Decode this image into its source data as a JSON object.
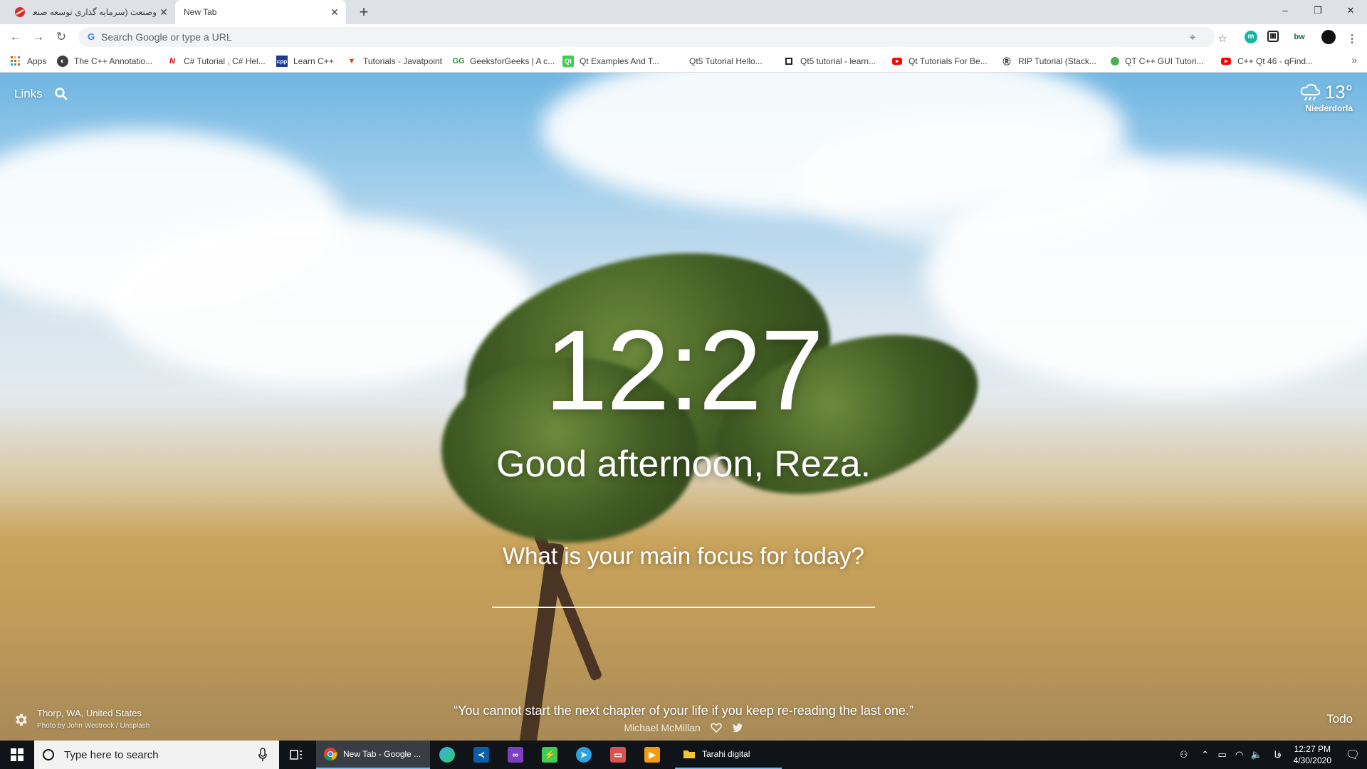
{
  "browser": {
    "tabs": [
      {
        "label": "وصنعت (سرمایه گذاری توسعه صنعت",
        "active": false
      },
      {
        "label": "New Tab",
        "active": true
      }
    ],
    "window_controls": {
      "minimize": "–",
      "restore": "❐",
      "close": "✕"
    }
  },
  "toolbar": {
    "omnibox_placeholder": "Search Google or type a URL"
  },
  "bookmarks": [
    {
      "label": "Apps",
      "icon": "apps-grid-icon"
    },
    {
      "label": "The C++ Annotatio...",
      "icon": "globe-icon"
    },
    {
      "label": "C# Tutorial , C# Hel...",
      "icon": "n-logo-icon"
    },
    {
      "label": "Learn C++",
      "icon": "cpp-logo-icon"
    },
    {
      "label": "Tutorials - Javatpoint",
      "icon": "javatpoint-logo-icon"
    },
    {
      "label": "GeeksforGeeks | A c...",
      "icon": "geeksforgeeks-logo-icon"
    },
    {
      "label": "Qt Examples And T...",
      "icon": "qt-logo-icon"
    },
    {
      "label": "Qt5 Tutorial Hello...",
      "icon": "blank-page-icon"
    },
    {
      "label": "Qt5 tutorial - learn...",
      "icon": "square-outline-icon"
    },
    {
      "label": "Qt Tutorials For Be...",
      "icon": "youtube-icon"
    },
    {
      "label": "RIP Tutorial (Stack...",
      "icon": "rip-logo-icon"
    },
    {
      "label": "QT C++ GUI Tutori...",
      "icon": "green-globe-icon"
    },
    {
      "label": "C++ Qt 46 - qFind...",
      "icon": "youtube-icon"
    }
  ],
  "momentum": {
    "links_label": "Links",
    "weather": {
      "temp": "13°",
      "location": "Niederdorla",
      "icon": "cloud-rain-icon"
    },
    "clock": "12:27",
    "greeting": "Good afternoon, Reza.",
    "focus_question": "What is your main focus for today?",
    "photo_location": "Thorp, WA, United States",
    "photo_credit": "Photo by John Westrock / Unsplash",
    "quote": "“You cannot start the next chapter of your life if you keep re-reading the last one.”",
    "quote_author": "Michael McMillan",
    "todo_label": "Todo"
  },
  "taskbar": {
    "search_placeholder": "Type here to search",
    "chrome_window_label": "New Tab - Google ...",
    "explorer_window_label": "Tarahi digital",
    "tray_language": "فا",
    "time": "12:27 PM",
    "date": "4/30/2020"
  },
  "colors": {
    "tab_strip": "#dee1e6",
    "taskbar": "#101418",
    "taskbar_active": "#3a3e44",
    "taskbar_accent": "#76b9ed"
  }
}
